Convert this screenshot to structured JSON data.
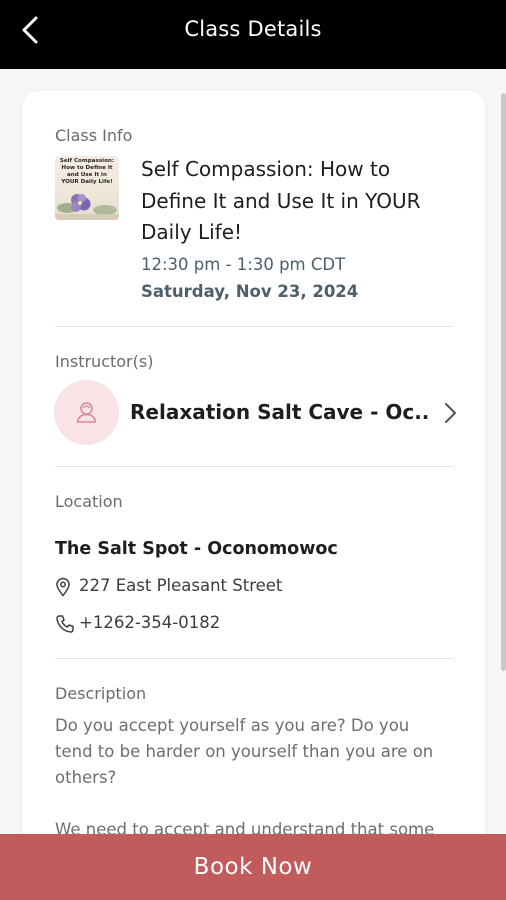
{
  "header": {
    "title": "Class Details",
    "back_icon": "back-arrow-icon"
  },
  "class_info": {
    "label": "Class Info",
    "thumbnail_text": "Self Compassion: How to Define It and Use It in YOUR Daily Life!",
    "title": "Self Compassion: How to Define It and Use It in YOUR Daily Life!",
    "time": "12:30 pm - 1:30 pm CDT",
    "date": "Saturday, Nov 23, 2024"
  },
  "instructors": {
    "label": "Instructor(s)",
    "name": "Relaxation Salt Cave - Oc...",
    "avatar_icon": "person-icon",
    "chevron_icon": "chevron-right-icon"
  },
  "location": {
    "label": "Location",
    "name": "The Salt Spot - Oconomowoc",
    "address": "227 East Pleasant Street",
    "phone": "+1262-354-0182"
  },
  "description": {
    "label": "Description",
    "paragraph1": "Do you accept yourself as you are?  Do you tend to be harder on yourself than you are on others?",
    "paragraph2": "We need to accept and understand that some"
  },
  "footer": {
    "book_label": "Book Now"
  },
  "colors": {
    "topbar": "#000000",
    "accent": "#c25c5c",
    "avatar_bg": "#f9e3e6",
    "time_text": "#4c5f6a"
  }
}
